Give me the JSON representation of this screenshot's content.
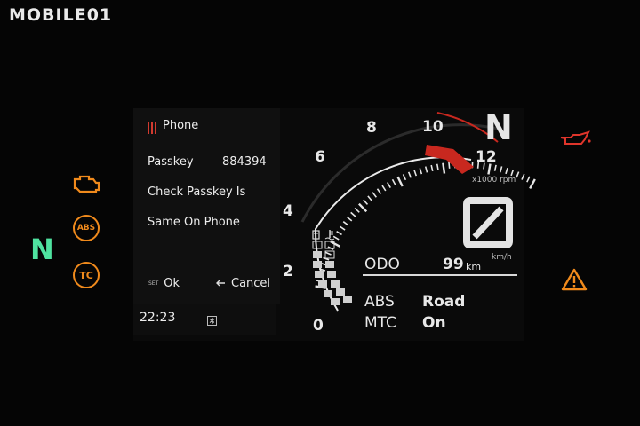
{
  "watermark": "MOBILE01",
  "phone_menu": {
    "title": "Phone",
    "passkey_label": "Passkey",
    "passkey_value": "884394",
    "message_line1": "Check Passkey Is",
    "message_line2": "Same On Phone",
    "ok_tag": "SET",
    "ok_label": "Ok",
    "cancel_label": "Cancel"
  },
  "clock": "22:23",
  "tachometer": {
    "ticks": [
      "0",
      "2",
      "4",
      "6",
      "8",
      "10",
      "12"
    ],
    "unit": "x1000 rpm",
    "redline_from": 10
  },
  "gear": "N",
  "left_gear": "N",
  "speed": {
    "value": "0",
    "unit": "km/h"
  },
  "odometer": {
    "label": "ODO",
    "value": "99",
    "unit": "km"
  },
  "abs": {
    "label": "ABS",
    "value": "Road"
  },
  "mtc": {
    "label": "MTC",
    "value": "On"
  },
  "warning_lamps": {
    "engine_color": "#f08a1c",
    "abs_text": "ABS",
    "tc_text": "TC",
    "oil_color": "#e0352b",
    "hazard_color": "#f08a1c"
  }
}
